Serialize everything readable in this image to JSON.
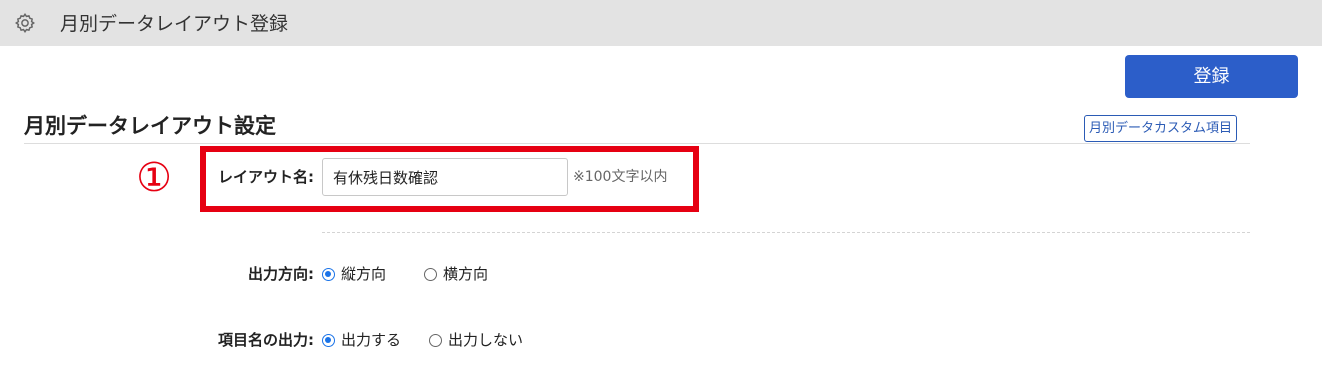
{
  "header": {
    "title": "月別データレイアウト登録",
    "icon": "gear-icon"
  },
  "toolbar": {
    "register_label": "登録"
  },
  "section": {
    "title": "月別データレイアウト設定",
    "custom_link_label": "月別データカスタム項目"
  },
  "annotation": {
    "step_number": "①",
    "highlight_color": "#e60012"
  },
  "form": {
    "layout_name": {
      "label": "レイアウト名:",
      "value": "有休残日数確認",
      "hint": "※100文字以内"
    },
    "output_direction": {
      "label": "出力方向:",
      "options": [
        {
          "label": "縦方向",
          "checked": true
        },
        {
          "label": "横方向",
          "checked": false
        }
      ]
    },
    "header_output": {
      "label": "項目名の出力:",
      "options": [
        {
          "label": "出力する",
          "checked": true
        },
        {
          "label": "出力しない",
          "checked": false
        }
      ]
    }
  },
  "colors": {
    "accent": "#2c5ec9",
    "link": "#2b5bb5",
    "header_bg": "#e3e3e3"
  }
}
